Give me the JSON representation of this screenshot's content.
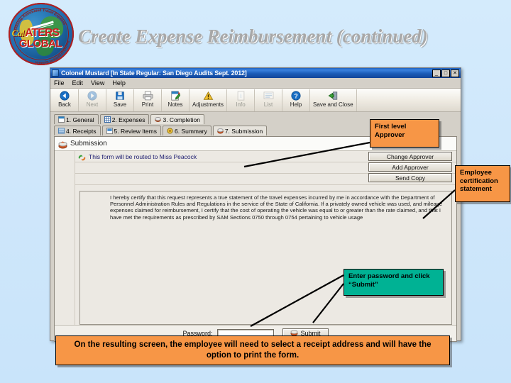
{
  "slide": {
    "title": "Create Expense Reimbursement (continued)",
    "background_color": "#cfe8fb",
    "title_color": "#a8a8a8"
  },
  "logo": {
    "name": "calaters-global-logo",
    "primary_text": "ATERS",
    "prefix_text": "Cal",
    "secondary_text": "GLOBAL",
    "arc_text_top": "California Automated Travel Expense",
    "arc_text_bottom": "Reimbursement System"
  },
  "window": {
    "title": "Colonel Mustard [In State Regular: San Diego Audits Sept. 2012]",
    "controls": {
      "minimize": "_",
      "maximize": "□",
      "close": "✕"
    },
    "menu": [
      "File",
      "Edit",
      "View",
      "Help"
    ],
    "toolbar": [
      {
        "label": "Back",
        "icon": "back-arrow-icon",
        "enabled": true
      },
      {
        "label": "Next",
        "icon": "forward-arrow-icon",
        "enabled": false
      },
      {
        "label": "Save",
        "icon": "floppy-disk-icon",
        "enabled": true
      },
      {
        "label": "Print",
        "icon": "printer-icon",
        "enabled": true
      },
      {
        "label": "Notes",
        "icon": "notes-pencil-icon",
        "enabled": true
      },
      {
        "label": "Adjustments",
        "icon": "warning-triangle-icon",
        "enabled": true
      },
      {
        "label": "Info",
        "icon": "info-document-icon",
        "enabled": false
      },
      {
        "label": "List",
        "icon": "list-icon",
        "enabled": false
      },
      {
        "label": "Help",
        "icon": "question-mark-icon",
        "enabled": true
      },
      {
        "label": "Save and Close",
        "icon": "save-and-close-icon",
        "enabled": true
      }
    ],
    "tabs_row1": [
      {
        "label": "1. General",
        "icon": "general-icon",
        "active": false
      },
      {
        "label": "2. Expenses",
        "icon": "grid-icon",
        "active": false
      },
      {
        "label": "3. Completion",
        "icon": "completion-icon",
        "active": true
      }
    ],
    "tabs_row2": [
      {
        "label": "4. Receipts",
        "icon": "receipts-icon",
        "active": false
      },
      {
        "label": "5. Review Items",
        "icon": "review-icon",
        "active": false
      },
      {
        "label": "6. Summary",
        "icon": "summary-icon",
        "active": false
      },
      {
        "label": "7. Submission",
        "icon": "submission-icon",
        "active": true
      }
    ],
    "panel": {
      "header": "Submission",
      "header_icon": "submission-icon",
      "approver_line": "This form will be routed to Miss Peacock",
      "approver_icon": "routing-icon",
      "buttons": [
        "Change Approver",
        "Add Approver",
        "Send Copy"
      ],
      "certification_text": "I hereby certify that this request represents a true statement of the travel expenses incurred by me in accordance with the Department of Personnel Administration Rules and Regulations in the service of the State of California. If a privately owned vehicle was used, and mileage expenses claimed for reimbursement, I certify that the cost of operating the vehicle was equal to or greater than the rate claimed, and that I have met the requirements as prescribed by SAM Sections 0750 through 0754 pertaining to vehicle usage"
    },
    "footer": {
      "password_label": "Password:",
      "password_value": "",
      "password_placeholder": "",
      "submit_label": "Submit",
      "submit_icon": "submit-icon"
    }
  },
  "callouts": [
    {
      "id": "first-level-approver",
      "text": "First level Approver",
      "color": "#F79646"
    },
    {
      "id": "employee-certification",
      "text": "Employee certification statement",
      "color": "#F79646"
    },
    {
      "id": "enter-password",
      "text": "Enter password and click “Submit”",
      "color": "#00B294"
    }
  ],
  "caption": {
    "text": "On the resulting screen, the employee will need to select a receipt address and will have the option to print the form.",
    "color": "#F79646"
  }
}
